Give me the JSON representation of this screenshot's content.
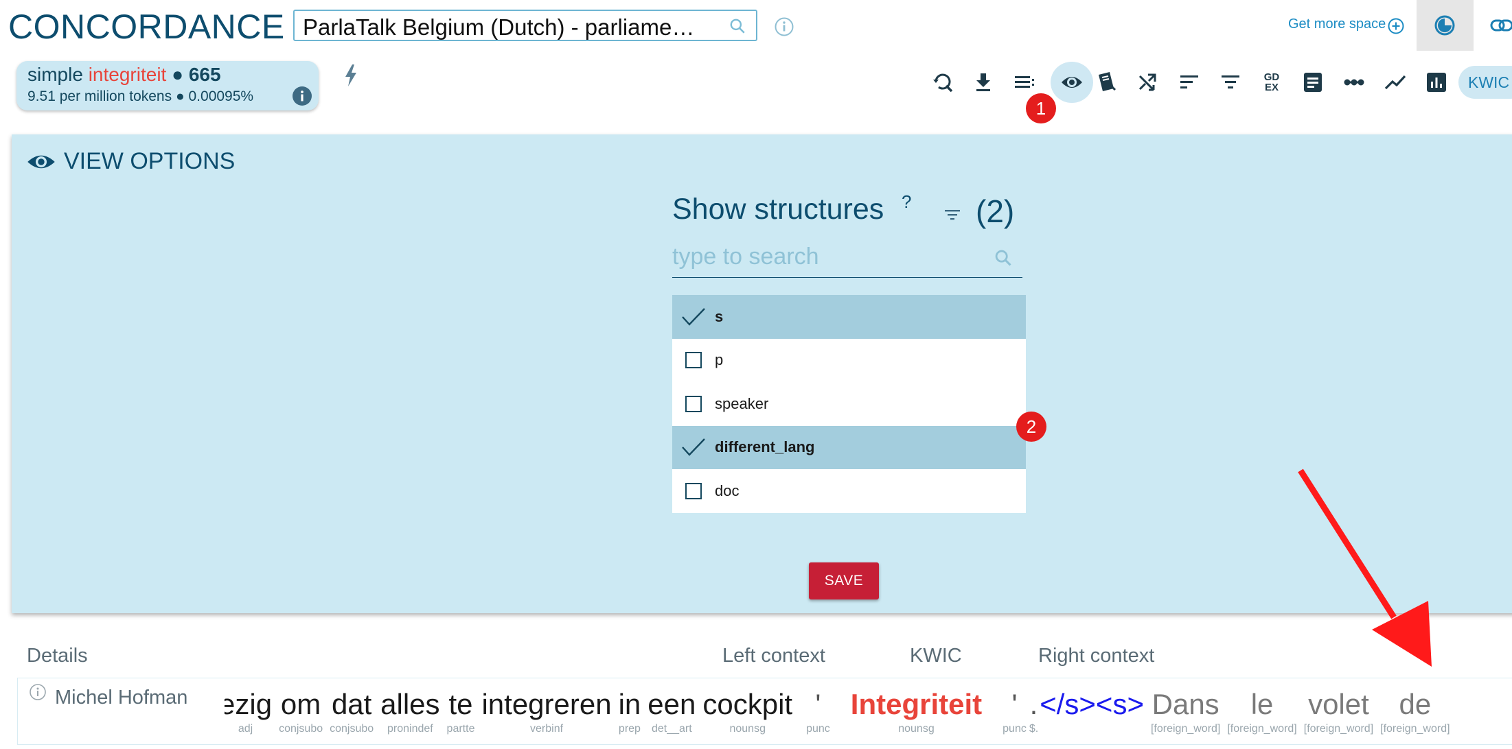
{
  "header": {
    "title": "CONCORDANCE",
    "corpus": "ParlaTalk Belgium (Dutch) - parliame…",
    "get_more_space": "Get more space"
  },
  "query": {
    "type": "simple",
    "term": "integriteit",
    "bullet": "●",
    "hits": "665",
    "frequency": "9.51 per million tokens",
    "percent": "0.00095%"
  },
  "toolbar": {
    "kwic_label": "KWIC",
    "gdex_label_top": "GD",
    "gdex_label_bottom": "EX",
    "badge_1": "1",
    "badge_2": "2"
  },
  "view_options": {
    "title": "VIEW OPTIONS",
    "structures_heading": "Show structures",
    "help_mark": "?",
    "selected_count": "(2)",
    "search_placeholder": "type to search",
    "items": [
      {
        "label": "s",
        "checked": true
      },
      {
        "label": "p",
        "checked": false
      },
      {
        "label": "speaker",
        "checked": false
      },
      {
        "label": "different_lang",
        "checked": true
      },
      {
        "label": "doc",
        "checked": false
      }
    ],
    "save_label": "SAVE"
  },
  "table": {
    "columns": {
      "details": "Details",
      "left": "Left context",
      "kwic": "KWIC",
      "right": "Right context"
    },
    "row": {
      "speaker": "Michel Hofman",
      "tokens": [
        {
          "w": "ezig",
          "t": "adj"
        },
        {
          "w": "om",
          "t": "conjsubo"
        },
        {
          "w": "dat",
          "t": "conjsubo"
        },
        {
          "w": "alles",
          "t": "pronindef"
        },
        {
          "w": "te",
          "t": "partte"
        },
        {
          "w": "integreren",
          "t": "verbinf"
        },
        {
          "w": "in",
          "t": "prep"
        },
        {
          "w": "een",
          "t": "det__art"
        },
        {
          "w": "cockpit",
          "t": "nounsg"
        },
        {
          "w": "'",
          "t": "punc"
        },
        {
          "w": "Integriteit",
          "t": "nounsg"
        },
        {
          "w": "'",
          "t": "punc"
        },
        {
          "w": ".",
          "t": "$."
        },
        {
          "w": "</s><s>",
          "t": ""
        },
        {
          "w": "Dans",
          "t": "[foreign_word]"
        },
        {
          "w": "le",
          "t": "[foreign_word]"
        },
        {
          "w": "volet",
          "t": "[foreign_word]"
        },
        {
          "w": "de",
          "t": "[foreign_word]"
        }
      ]
    }
  }
}
